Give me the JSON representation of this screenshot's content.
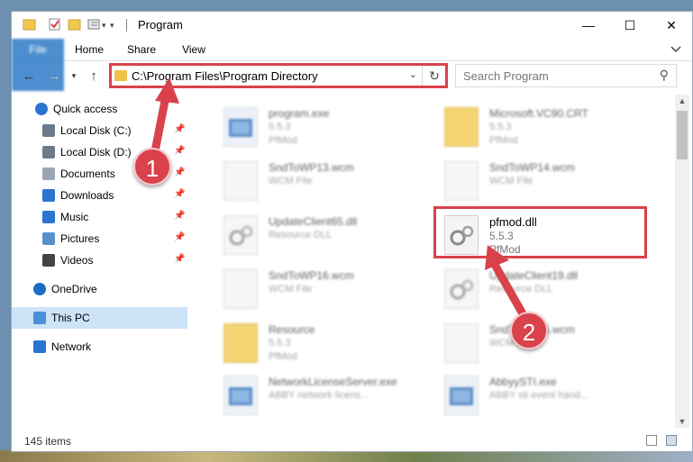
{
  "window": {
    "title": "Program"
  },
  "ribbon": {
    "tabs": [
      "File",
      "Home",
      "Share",
      "View"
    ]
  },
  "address": {
    "path": "C:\\Program Files\\Program Directory"
  },
  "search": {
    "placeholder": "Search Program"
  },
  "nav": {
    "items": [
      {
        "label": "Quick access",
        "icon": "star-icon",
        "pinned": false
      },
      {
        "label": "Local Disk (C:)",
        "icon": "drive-icon",
        "pinned": true
      },
      {
        "label": "Local Disk (D:)",
        "icon": "drive-icon",
        "pinned": true
      },
      {
        "label": "Documents",
        "icon": "documents-icon",
        "pinned": true
      },
      {
        "label": "Downloads",
        "icon": "download-icon",
        "pinned": true
      },
      {
        "label": "Music",
        "icon": "music-icon",
        "pinned": true
      },
      {
        "label": "Pictures",
        "icon": "pictures-icon",
        "pinned": true
      },
      {
        "label": "Videos",
        "icon": "videos-icon",
        "pinned": true
      },
      {
        "label": "OneDrive",
        "icon": "cloud-icon",
        "pinned": false
      },
      {
        "label": "This PC",
        "icon": "computer-icon",
        "pinned": false,
        "selected": true
      },
      {
        "label": "Network",
        "icon": "network-icon",
        "pinned": false
      }
    ]
  },
  "files": [
    {
      "name": "program.exe",
      "line2": "5.5.3",
      "line3": "PfMod",
      "type": "exe"
    },
    {
      "name": "Microsoft.VC90.CRT",
      "line2": "5.5.3",
      "line3": "PfMod",
      "type": "folder"
    },
    {
      "name": "SndToWP13.wcm",
      "line2": "WCM File",
      "line3": "",
      "type": "file"
    },
    {
      "name": "SndToWP14.wcm",
      "line2": "WCM File",
      "line3": "",
      "type": "file"
    },
    {
      "name": "UpdateClient65.dll",
      "line2": "Resource DLL",
      "line3": "",
      "type": "dll"
    },
    {
      "name": "pfmod.dll",
      "line2": "5.5.3",
      "line3": "PfMod",
      "type": "dll",
      "highlighted": true
    },
    {
      "name": "SndToWP16.wcm",
      "line2": "WCM File",
      "line3": "",
      "type": "file"
    },
    {
      "name": "UpdateClient19.dll",
      "line2": "Resource DLL",
      "line3": "",
      "type": "dll"
    },
    {
      "name": "Resource",
      "line2": "5.5.3",
      "line3": "PfMod",
      "type": "folder"
    },
    {
      "name": "SndToWP15.wcm",
      "line2": "WCM File",
      "line3": "",
      "type": "file"
    },
    {
      "name": "NetworkLicenseServer.exe",
      "line2": "ABBY network licens...",
      "line3": "",
      "type": "exe"
    },
    {
      "name": "AbbyySTI.exe",
      "line2": "ABBY sti event hand...",
      "line3": "",
      "type": "exe"
    }
  ],
  "status": {
    "item_count": "145 items"
  },
  "callouts": {
    "one": "1",
    "two": "2"
  },
  "colors": {
    "accent": "#1a6fc2",
    "highlight": "#d9424a",
    "selection": "#cce3f8"
  }
}
